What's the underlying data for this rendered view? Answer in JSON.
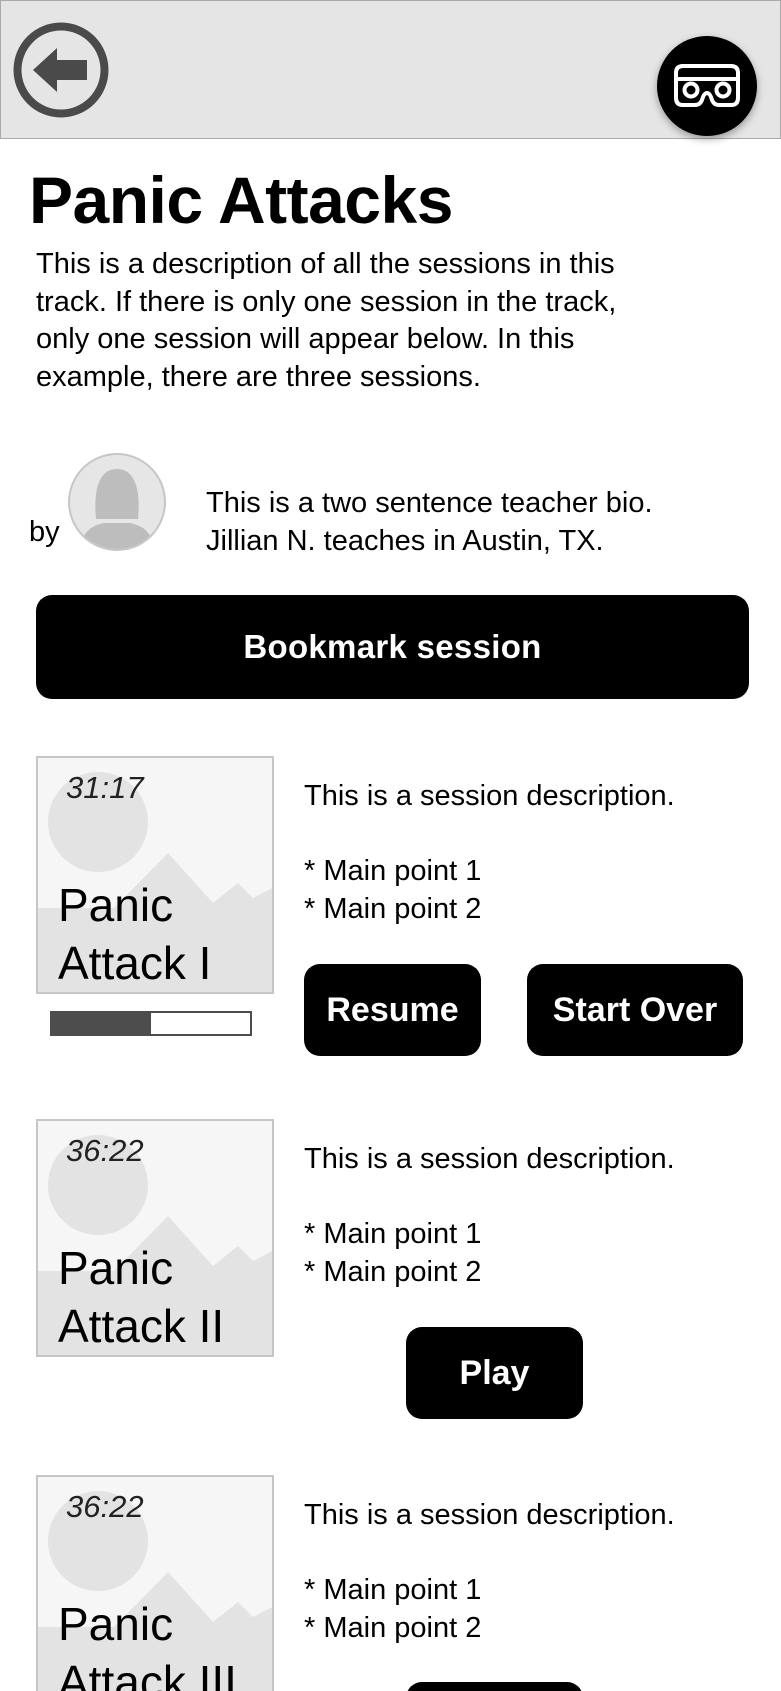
{
  "header": {
    "back_icon": "back-arrow-icon",
    "vr_icon": "vr-headset-icon"
  },
  "track": {
    "title": "Panic Attacks",
    "description": "This is a description of all the sessions in this track. If there is only one session in the track, only one session will appear below. In this example, there are three sessions."
  },
  "teacher": {
    "by_label": "by",
    "bio_line1": "This is a two sentence teacher bio.",
    "bio_line2": "Jillian N. teaches in Austin, TX."
  },
  "bookmark": {
    "label": "Bookmark session"
  },
  "sessions": [
    {
      "duration": "31:17",
      "title_line1": "Panic",
      "title_line2": "Attack I",
      "description": "This is a session description.",
      "point1": "* Main point 1",
      "point2": "* Main point 2",
      "progress": 0.5,
      "resume_label": "Resume",
      "start_over_label": "Start Over"
    },
    {
      "duration": "36:22",
      "title_line1": "Panic",
      "title_line2": "Attack II",
      "description": "This is a session description.",
      "point1": "* Main point 1",
      "point2": "* Main point 2",
      "play_label": "Play"
    },
    {
      "duration": "36:22",
      "title_line1": "Panic",
      "title_line2": "Attack III",
      "description": "This is a session description.",
      "point1": "* Main point 1",
      "point2": "* Main point 2"
    }
  ],
  "colors": {
    "header_bg": "#e5e5e5",
    "button_bg": "#000000",
    "button_text": "#ffffff",
    "thumb_bg": "#f6f6f6",
    "progress_fill": "#4d4d4d"
  }
}
